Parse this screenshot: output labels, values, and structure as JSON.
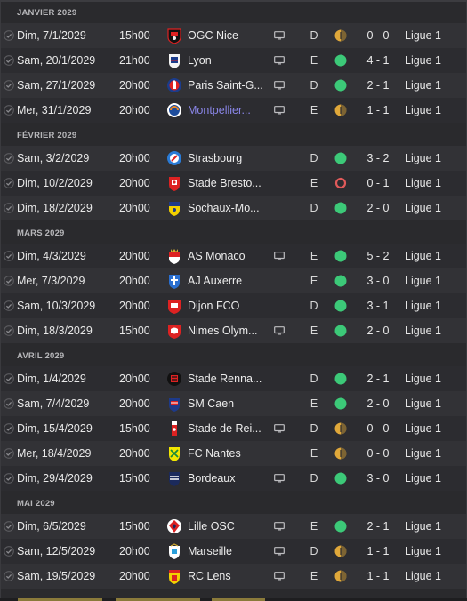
{
  "colors": {
    "win": "#3cc978",
    "draw": "#e0a83a",
    "loss": "#e05a5a",
    "link": "#8a86e8"
  },
  "months": [
    {
      "label": "JANVIER 2029",
      "matches": [
        {
          "date": "Dim, 7/1/2029",
          "time": "15h00",
          "team": "OGC Nice",
          "badge": "nice-badge",
          "tv": true,
          "venue": "D",
          "result": "draw",
          "score": "0 - 0",
          "comp": "Ligue 1"
        },
        {
          "date": "Sam, 20/1/2029",
          "time": "21h00",
          "team": "Lyon",
          "badge": "lyon-badge",
          "tv": true,
          "venue": "E",
          "result": "win",
          "score": "4 - 1",
          "comp": "Ligue 1"
        },
        {
          "date": "Sam, 27/1/2029",
          "time": "20h00",
          "team": "Paris Saint-G...",
          "badge": "psg-badge",
          "tv": true,
          "venue": "D",
          "result": "win",
          "score": "2 - 1",
          "comp": "Ligue 1"
        },
        {
          "date": "Mer, 31/1/2029",
          "time": "20h00",
          "team": "Montpellier...",
          "badge": "montpellier-badge",
          "tv": true,
          "venue": "E",
          "result": "draw",
          "score": "1 - 1",
          "comp": "Ligue 1",
          "link": true
        }
      ]
    },
    {
      "label": "FÉVRIER 2029",
      "matches": [
        {
          "date": "Sam, 3/2/2029",
          "time": "20h00",
          "team": "Strasbourg",
          "badge": "strasbourg-badge",
          "tv": false,
          "venue": "D",
          "result": "win",
          "score": "3 - 2",
          "comp": "Ligue 1"
        },
        {
          "date": "Dim, 10/2/2029",
          "time": "20h00",
          "team": "Stade Bresto...",
          "badge": "brest-badge",
          "tv": false,
          "venue": "E",
          "result": "loss",
          "score": "0 - 1",
          "comp": "Ligue 1"
        },
        {
          "date": "Dim, 18/2/2029",
          "time": "20h00",
          "team": "Sochaux-Mo...",
          "badge": "sochaux-badge",
          "tv": false,
          "venue": "D",
          "result": "win",
          "score": "2 - 0",
          "comp": "Ligue 1"
        }
      ]
    },
    {
      "label": "MARS 2029",
      "matches": [
        {
          "date": "Dim, 4/3/2029",
          "time": "20h00",
          "team": "AS Monaco",
          "badge": "monaco-badge",
          "tv": true,
          "venue": "E",
          "result": "win",
          "score": "5 - 2",
          "comp": "Ligue 1"
        },
        {
          "date": "Mer, 7/3/2029",
          "time": "20h00",
          "team": "AJ Auxerre",
          "badge": "auxerre-badge",
          "tv": false,
          "venue": "E",
          "result": "win",
          "score": "3 - 0",
          "comp": "Ligue 1"
        },
        {
          "date": "Sam, 10/3/2029",
          "time": "20h00",
          "team": "Dijon FCO",
          "badge": "dijon-badge",
          "tv": false,
          "venue": "D",
          "result": "win",
          "score": "3 - 1",
          "comp": "Ligue 1"
        },
        {
          "date": "Dim, 18/3/2029",
          "time": "15h00",
          "team": "Nimes Olym...",
          "badge": "nimes-badge",
          "tv": true,
          "venue": "E",
          "result": "win",
          "score": "2 - 0",
          "comp": "Ligue 1"
        }
      ]
    },
    {
      "label": "AVRIL 2029",
      "matches": [
        {
          "date": "Dim, 1/4/2029",
          "time": "20h00",
          "team": "Stade Renna...",
          "badge": "rennes-badge",
          "tv": false,
          "venue": "D",
          "result": "win",
          "score": "2 - 1",
          "comp": "Ligue 1"
        },
        {
          "date": "Sam, 7/4/2029",
          "time": "20h00",
          "team": "SM Caen",
          "badge": "caen-badge",
          "tv": false,
          "venue": "E",
          "result": "win",
          "score": "2 - 0",
          "comp": "Ligue 1"
        },
        {
          "date": "Dim, 15/4/2029",
          "time": "15h00",
          "team": "Stade de Rei...",
          "badge": "reims-badge",
          "tv": true,
          "venue": "D",
          "result": "draw",
          "score": "0 - 0",
          "comp": "Ligue 1"
        },
        {
          "date": "Mer, 18/4/2029",
          "time": "20h00",
          "team": "FC Nantes",
          "badge": "nantes-badge",
          "tv": false,
          "venue": "E",
          "result": "draw",
          "score": "0 - 0",
          "comp": "Ligue 1"
        },
        {
          "date": "Dim, 29/4/2029",
          "time": "15h00",
          "team": "Bordeaux",
          "badge": "bordeaux-badge",
          "tv": true,
          "venue": "D",
          "result": "win",
          "score": "3 - 0",
          "comp": "Ligue 1"
        }
      ]
    },
    {
      "label": "MAI 2029",
      "matches": [
        {
          "date": "Dim, 6/5/2029",
          "time": "15h00",
          "team": "Lille OSC",
          "badge": "lille-badge",
          "tv": true,
          "venue": "E",
          "result": "win",
          "score": "2 - 1",
          "comp": "Ligue 1"
        },
        {
          "date": "Sam, 12/5/2029",
          "time": "20h00",
          "team": "Marseille",
          "badge": "marseille-badge",
          "tv": true,
          "venue": "D",
          "result": "draw",
          "score": "1 - 1",
          "comp": "Ligue 1"
        },
        {
          "date": "Sam, 19/5/2029",
          "time": "20h00",
          "team": "RC Lens",
          "badge": "lens-badge",
          "tv": true,
          "venue": "E",
          "result": "draw",
          "score": "1 - 1",
          "comp": "Ligue 1"
        }
      ]
    }
  ]
}
